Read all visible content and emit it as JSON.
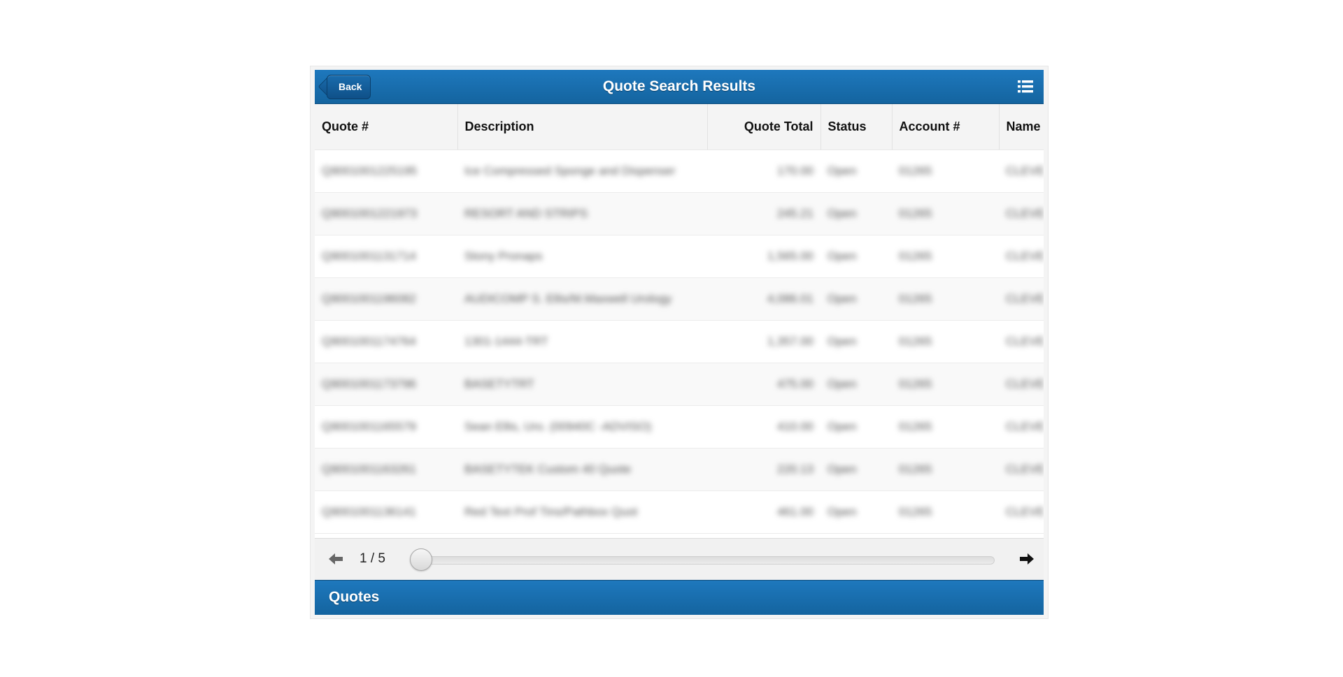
{
  "header": {
    "title": "Quote Search Results",
    "back_label": "Back",
    "menu_icon": "list-menu-icon"
  },
  "table": {
    "columns": [
      "Quote #",
      "Description",
      "Quote Total",
      "Status",
      "Account #",
      "Name"
    ],
    "rows": [
      [
        "Q9001001225195",
        "Ice Compressed Sponge and Dispenser",
        "170.00",
        "Open",
        "01265",
        "CLEVE"
      ],
      [
        "Q9001001221973",
        "RESORT AND STRIPS",
        "245.21",
        "Open",
        "01265",
        "CLEVE"
      ],
      [
        "Q9001001131714",
        "Stony Pronaps",
        "1,565.00",
        "Open",
        "01265",
        "CLEVE"
      ],
      [
        "Q9001001196082",
        "AUDICOMP S. Ellis/M.Maxwell Urology",
        "4,086.01",
        "Open",
        "01265",
        "CLEVE"
      ],
      [
        "Q9001001174764",
        "1301-1444-TRT",
        "1,357.00",
        "Open",
        "01265",
        "CLEVE"
      ],
      [
        "Q9001001173796",
        "BASETYTRT",
        "475.00",
        "Open",
        "01265",
        "CLEVE"
      ],
      [
        "Q9001001165579",
        "Sean Ellis, Uro. (00940C -ADVISO)",
        "410.00",
        "Open",
        "01265",
        "CLEVE"
      ],
      [
        "Q9001001163261",
        "BASETYTEK Custom 40 Quote",
        "220.13",
        "Open",
        "01265",
        "CLEVE"
      ],
      [
        "Q9001001136141",
        "Red Text Prof Tins/Pathbox Quot",
        "461.00",
        "Open",
        "01265",
        "CLEVE"
      ]
    ]
  },
  "pager": {
    "page_text": "1 / 5",
    "current_page": 1,
    "total_pages": 5,
    "prev_icon": "arrow-left-icon",
    "next_icon": "arrow-right-icon"
  },
  "footer": {
    "title": "Quotes"
  },
  "colors": {
    "header_blue": "#1a6fb0",
    "pager_bg": "#f1f1f1"
  }
}
